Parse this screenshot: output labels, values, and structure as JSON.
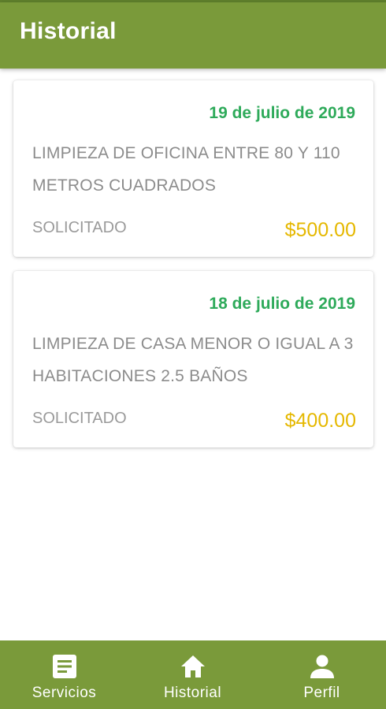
{
  "appbar": {
    "title": "Historial"
  },
  "history": [
    {
      "date": "19 de julio de 2019",
      "description": "LIMPIEZA DE OFICINA ENTRE 80 Y 110 METROS CUADRADOS",
      "status": "SOLICITADO",
      "price": "$500.00"
    },
    {
      "date": "18 de julio de 2019",
      "description": "LIMPIEZA DE CASA MENOR O IGUAL A 3 HABITACIONES 2.5 BAÑOS",
      "status": "SOLICITADO",
      "price": "$400.00"
    }
  ],
  "bottom_nav": {
    "items": [
      {
        "label": "Servicios",
        "icon": "document-list-icon"
      },
      {
        "label": "Historial",
        "icon": "home-icon"
      },
      {
        "label": "Perfil",
        "icon": "person-icon"
      }
    ]
  },
  "colors": {
    "primary": "#7a9a3a",
    "date": "#2eaa5a",
    "price": "#e5b800",
    "muted_text": "#8c8c8c"
  }
}
